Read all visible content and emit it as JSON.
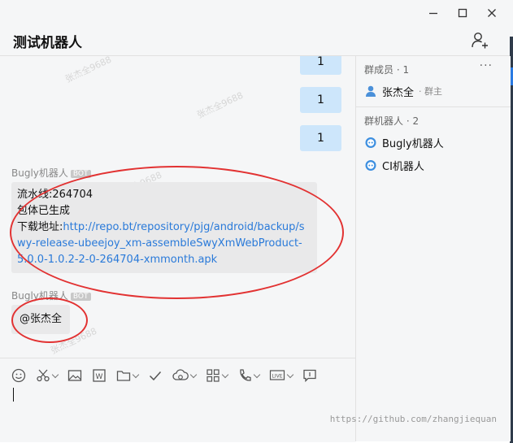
{
  "window": {
    "title": "测试机器人"
  },
  "messages": {
    "mine": [
      "1",
      "1",
      "1"
    ],
    "bot1": {
      "sender": "Bugly机器人",
      "tag": "BOT",
      "line1": "流水线:264704",
      "line2": "包体已生成",
      "link_prefix": "下载地址:",
      "link": "http://repo.bt/repository/pjg/android/backup/swy-release-ubeejoy_xm-assembleSwyXmWebProduct-5.0.0-1.0.2-2-0-264704-xmmonth.apk"
    },
    "bot2": {
      "sender": "Bugly机器人",
      "tag": "BOT",
      "text": "@张杰全"
    },
    "watermarks": [
      "张杰全9688",
      "张杰全9688",
      "张杰全9688",
      "张杰全9688"
    ]
  },
  "sidebar": {
    "members_heading": "群成员 · 1",
    "more": "···",
    "member": {
      "name": "张杰全",
      "role": "· 群主"
    },
    "bots_heading": "群机器人 · 2",
    "bots": [
      "Bugly机器人",
      "CI机器人"
    ]
  },
  "compose": {
    "tools": [
      "emoji-icon",
      "scissors-icon",
      "image-icon",
      "word-icon",
      "folder-icon",
      "check-icon",
      "cloud-icon",
      "apps-icon",
      "phone-icon",
      "live-icon",
      "comment-icon"
    ]
  },
  "footer": {
    "watermark": "https://github.com/zhangjiequan"
  },
  "colors": {
    "my_bubble": "#cde6fb",
    "bot_bubble": "#e9e9ea",
    "link": "#2a7ad9",
    "annotation": "#e23232"
  }
}
